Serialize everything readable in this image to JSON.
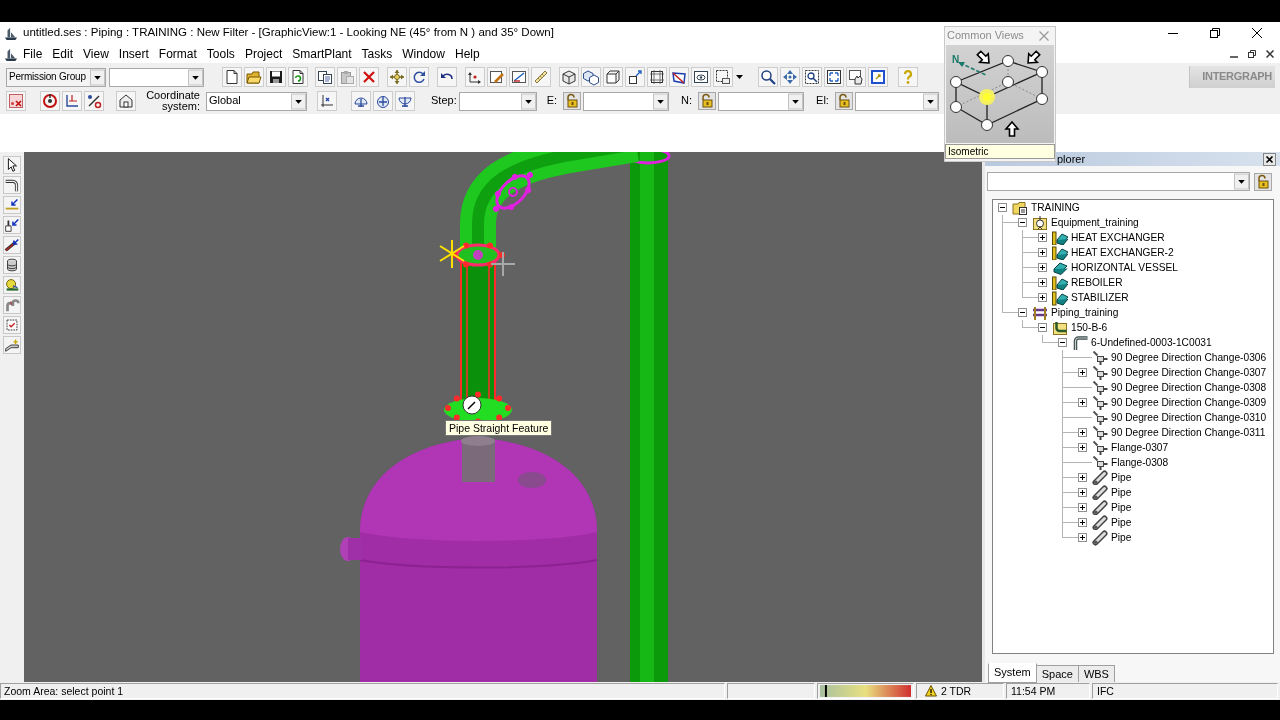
{
  "window": {
    "title": "untitled.ses : Piping : TRAINING : New Filter - [GraphicView:1 - Looking NE (45° from N ) and 35° Down]"
  },
  "menu": [
    "File",
    "Edit",
    "View",
    "Insert",
    "Format",
    "Tools",
    "Project",
    "SmartPlant",
    "Tasks",
    "Window",
    "Help"
  ],
  "toolbar": {
    "permission_group": {
      "value": "Permission Group"
    },
    "logo": "INTERGRAPH"
  },
  "pinpoint_bar": {
    "coordinate_system_label": "Coordinate system:",
    "coordinate_system": "Global",
    "step_label": "Step:",
    "axes": [
      {
        "label": "E:"
      },
      {
        "label": "N:"
      },
      {
        "label": "El:"
      }
    ]
  },
  "common_views": {
    "title": "Common Views",
    "north_label": "N",
    "view_label": "Isometric"
  },
  "graphic_view": {
    "tooltip": "Pipe Straight Feature"
  },
  "workspace_explorer": {
    "title": "plorer",
    "tree": [
      {
        "label": "TRAINING",
        "kind": "workspace",
        "expanded": true,
        "children": [
          {
            "label": "Equipment_training",
            "kind": "system",
            "expanded": true,
            "children": [
              {
                "label": "HEAT EXCHANGER",
                "kind": "equipment",
                "expanded": false
              },
              {
                "label": "HEAT EXCHANGER-2",
                "kind": "equipment",
                "expanded": false
              },
              {
                "label": "HORIZONTAL VESSEL",
                "kind": "vessel",
                "expanded": false
              },
              {
                "label": "REBOILER",
                "kind": "equipment",
                "expanded": false
              },
              {
                "label": "STABILIZER",
                "kind": "equipment",
                "expanded": false
              }
            ]
          },
          {
            "label": "Piping_training",
            "kind": "piping_system",
            "expanded": true,
            "children": [
              {
                "label": "150-B-6",
                "kind": "pipeline",
                "expanded": true,
                "children": [
                  {
                    "label": "6-Undefined-0003-1C0031",
                    "kind": "pipe_run",
                    "expanded": true,
                    "children": [
                      {
                        "label": "90 Degree Direction Change-0306",
                        "kind": "feature"
                      },
                      {
                        "label": "90 Degree Direction Change-0307",
                        "kind": "feature",
                        "expanded": false
                      },
                      {
                        "label": "90 Degree Direction Change-0308",
                        "kind": "feature"
                      },
                      {
                        "label": "90 Degree Direction Change-0309",
                        "kind": "feature",
                        "expanded": false
                      },
                      {
                        "label": "90 Degree Direction Change-0310",
                        "kind": "feature"
                      },
                      {
                        "label": "90 Degree Direction Change-0311",
                        "kind": "feature",
                        "expanded": false
                      },
                      {
                        "label": "Flange-0307",
                        "kind": "feature",
                        "expanded": false
                      },
                      {
                        "label": "Flange-0308",
                        "kind": "feature"
                      },
                      {
                        "label": "Pipe",
                        "kind": "pipe",
                        "expanded": false
                      },
                      {
                        "label": "Pipe",
                        "kind": "pipe",
                        "expanded": false
                      },
                      {
                        "label": "Pipe",
                        "kind": "pipe",
                        "expanded": false
                      },
                      {
                        "label": "Pipe",
                        "kind": "pipe",
                        "expanded": false
                      },
                      {
                        "label": "Pipe",
                        "kind": "pipe",
                        "expanded": false
                      }
                    ]
                  }
                ]
              }
            ]
          }
        ]
      }
    ],
    "tabs": [
      {
        "label": "System",
        "selected": true
      },
      {
        "label": "Space",
        "selected": false
      },
      {
        "label": "WBS",
        "selected": false
      }
    ]
  },
  "status_bar": {
    "prompt": "Zoom Area: select point 1",
    "warning": "2 TDR",
    "time": "11:54 PM",
    "mode": "IFC"
  }
}
